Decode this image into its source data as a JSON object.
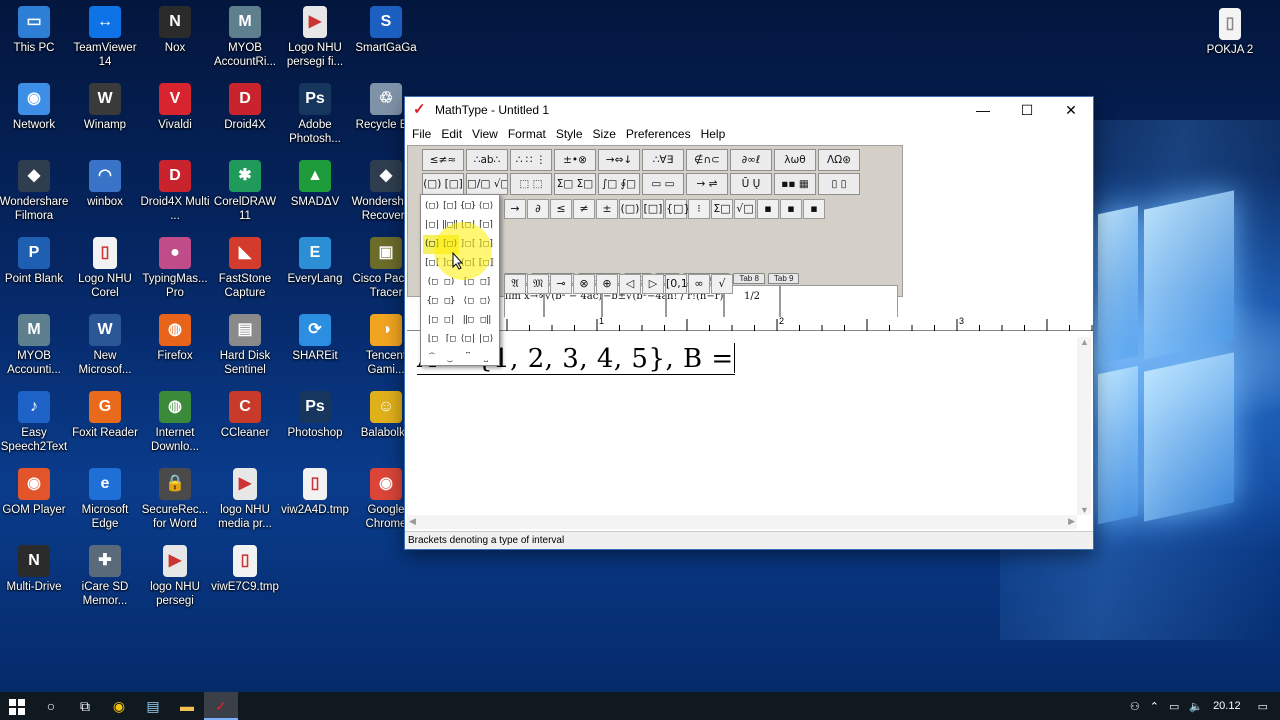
{
  "desktop": {
    "icons": [
      {
        "label": "This PC",
        "color": "#2d7fd6",
        "glyph": "▭"
      },
      {
        "label": "TeamViewer 14",
        "color": "#0e73e6",
        "glyph": "↔"
      },
      {
        "label": "Nox",
        "color": "#2b2b2b",
        "glyph": "N"
      },
      {
        "label": "MYOB AccountRi...",
        "color": "#5d7f8e",
        "glyph": "M"
      },
      {
        "label": "Logo NHU persegi fi...",
        "color": "#e7e7e7",
        "glyph": "▶"
      },
      {
        "label": "SmartGaGa",
        "color": "#1b5fc0",
        "glyph": "S"
      },
      {
        "label": "Network",
        "color": "#3d8ee6",
        "glyph": "◉"
      },
      {
        "label": "Winamp",
        "color": "#3a3a3a",
        "glyph": "W"
      },
      {
        "label": "Vivaldi",
        "color": "#d8242e",
        "glyph": "V"
      },
      {
        "label": "Droid4X",
        "color": "#c9242e",
        "glyph": "D"
      },
      {
        "label": "Adobe Photosh...",
        "color": "#17365d",
        "glyph": "Ps"
      },
      {
        "label": "Recycle Bin",
        "color": "#7f93a8",
        "glyph": "♲"
      },
      {
        "label": "Wondershare Filmora",
        "color": "#2f3e4f",
        "glyph": "◆"
      },
      {
        "label": "winbox",
        "color": "#3a74c8",
        "glyph": "◠"
      },
      {
        "label": "Droid4X Multi ...",
        "color": "#c9242e",
        "glyph": "D"
      },
      {
        "label": "CorelDRAW 11",
        "color": "#1f9a5a",
        "glyph": "✱"
      },
      {
        "label": "SMADΔV",
        "color": "#1e9b3a",
        "glyph": "▲"
      },
      {
        "label": "Wondershare Recoverit",
        "color": "#2f3e4f",
        "glyph": "◆"
      },
      {
        "label": "Point Blank",
        "color": "#1e5fb2",
        "glyph": "P"
      },
      {
        "label": "Logo NHU Corel",
        "color": "#f2f2f2",
        "glyph": "▯"
      },
      {
        "label": "TypingMas... Pro",
        "color": "#c04c8a",
        "glyph": "●"
      },
      {
        "label": "FastStone Capture",
        "color": "#d33b2c",
        "glyph": "◣"
      },
      {
        "label": "EveryLang",
        "color": "#2c8fd6",
        "glyph": "E"
      },
      {
        "label": "Cisco Packet Tracer",
        "color": "#6b6b2a",
        "glyph": "▣"
      },
      {
        "label": "MYOB Accounti...",
        "color": "#5d7f8e",
        "glyph": "M"
      },
      {
        "label": "New Microsof...",
        "color": "#2b5797",
        "glyph": "W"
      },
      {
        "label": "Firefox",
        "color": "#e8641b",
        "glyph": "◍"
      },
      {
        "label": "Hard Disk Sentinel",
        "color": "#8a8a8a",
        "glyph": "▤"
      },
      {
        "label": "SHAREit",
        "color": "#2b8ee0",
        "glyph": "⟳"
      },
      {
        "label": "Tencent Gami...",
        "color": "#f0a420",
        "glyph": "◑"
      },
      {
        "label": "Easy Speech2Text",
        "color": "#1e62c8",
        "glyph": "♪"
      },
      {
        "label": "Foxit Reader",
        "color": "#e86a1a",
        "glyph": "G"
      },
      {
        "label": "Internet Downlo...",
        "color": "#3a8a3a",
        "glyph": "◍"
      },
      {
        "label": "CCleaner",
        "color": "#c83a2a",
        "glyph": "C"
      },
      {
        "label": "Photoshop",
        "color": "#17365d",
        "glyph": "Ps"
      },
      {
        "label": "Balabolka",
        "color": "#e0b01a",
        "glyph": "☺"
      },
      {
        "label": "GOM Player",
        "color": "#e2542a",
        "glyph": "◉"
      },
      {
        "label": "Microsoft Edge",
        "color": "#1e6fd6",
        "glyph": "e"
      },
      {
        "label": "SecureRec... for Word",
        "color": "#4a4a4a",
        "glyph": "🔒"
      },
      {
        "label": "logo NHU media pr...",
        "color": "#e7e7e7",
        "glyph": "▶"
      },
      {
        "label": "viw2A4D.tmp",
        "color": "#f2f2f2",
        "glyph": "▯"
      },
      {
        "label": "Google Chrome",
        "color": "#db4437",
        "glyph": "◉"
      },
      {
        "label": "Multi-Drive",
        "color": "#2b2b2b",
        "glyph": "N"
      },
      {
        "label": "iCare SD Memor...",
        "color": "#5a6a7a",
        "glyph": "✚"
      },
      {
        "label": "logo NHU persegi",
        "color": "#e7e7e7",
        "glyph": "▶"
      },
      {
        "label": "viwE7C9.tmp",
        "color": "#f2f2f2",
        "glyph": "▯"
      }
    ],
    "right_icon": {
      "label": "POKJA 2",
      "glyph": "▯"
    }
  },
  "mathtype": {
    "title": "MathType - Untitled 1",
    "menu": [
      "File",
      "Edit",
      "View",
      "Format",
      "Style",
      "Size",
      "Preferences",
      "Help"
    ],
    "palette_row1": [
      "≤≠≈",
      "∴ab∴",
      "∴ ∷ ⋮",
      "±•⊗",
      "→⇔↓",
      "∴∀∃",
      "∉∩⊂",
      "∂∞ℓ",
      "λωθ",
      "ΛΩ⊛"
    ],
    "palette_row2": [
      "(□) [□]",
      "□/□ √□",
      "⬚ ⬚",
      "Σ□ Σ□",
      "∫□ ∮□",
      "▭ ▭",
      "→ ⇌",
      "Ū Ų",
      "▪▪ ▦",
      "▯ ▯"
    ],
    "small_row": [
      "→",
      "∂",
      "≤",
      "≠",
      "±",
      "(□)",
      "[□]",
      "{□}",
      "⁝",
      "Σ□",
      "√□",
      "▪",
      "▪",
      "▪"
    ],
    "tabs": [
      "rivs",
      "Statistics",
      "Matrices",
      "Sets",
      "Trig",
      "Geometry",
      "Tab 8",
      "Tab 9"
    ],
    "templates": [
      "lim x→∞",
      "√(b² − 4ac)",
      "−b±√(b²−4ac) / 2a",
      "n! / r!(n−r)!",
      "1/2"
    ],
    "bottom_row": [
      "𝔄",
      "𝔐",
      "⊸",
      "⊗",
      "⊕",
      "◁",
      "▷",
      "[0,1]",
      "∞",
      "√"
    ],
    "ruler_numbers": [
      "1",
      "2",
      "3"
    ],
    "equation": "A = {1, 2, 3, 4, 5}, B =",
    "status": "Brackets denoting a type of interval",
    "dropdown_rows": [
      [
        "(□)",
        "[□]",
        "{□}",
        "⟨□⟩"
      ],
      [
        "|□|",
        "‖□‖",
        "⌊□⌋",
        "⌈□⌉"
      ],
      [
        "(□]",
        "[□)",
        "]□[",
        "]□]"
      ],
      [
        "[□[",
        "]□)",
        "(□[",
        "⟦□⟧"
      ],
      [
        "(□",
        "□)",
        "[□",
        "□]"
      ],
      [
        "{□",
        "□}",
        "⟨□",
        "□⟩"
      ],
      [
        "|□",
        "□|",
        "‖□",
        "□‖"
      ],
      [
        "⌊□",
        "⌈□",
        "⟨□|",
        "|□⟩"
      ],
      [
        "⏞",
        "⏟",
        "⎴",
        "⎵"
      ]
    ]
  },
  "taskbar": {
    "items": [
      "start",
      "search",
      "task-view",
      "chrome",
      "notepad",
      "explorer",
      "mathtype"
    ],
    "time": "20.12"
  }
}
